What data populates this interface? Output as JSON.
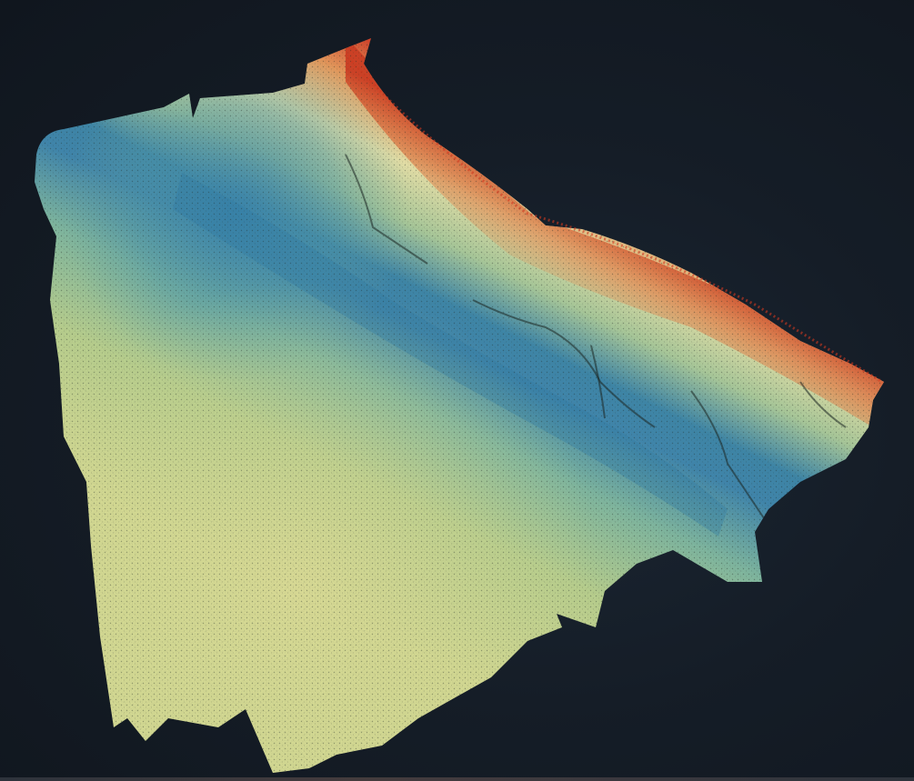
{
  "scene": {
    "background_color": "#141c25",
    "colormap": [
      "#d9492a",
      "#e8a45a",
      "#e9e2a0",
      "#c9d98c",
      "#7fb89a",
      "#3f8fb0",
      "#2a6fa3"
    ],
    "subject": "bathymetry-point-cloud"
  }
}
